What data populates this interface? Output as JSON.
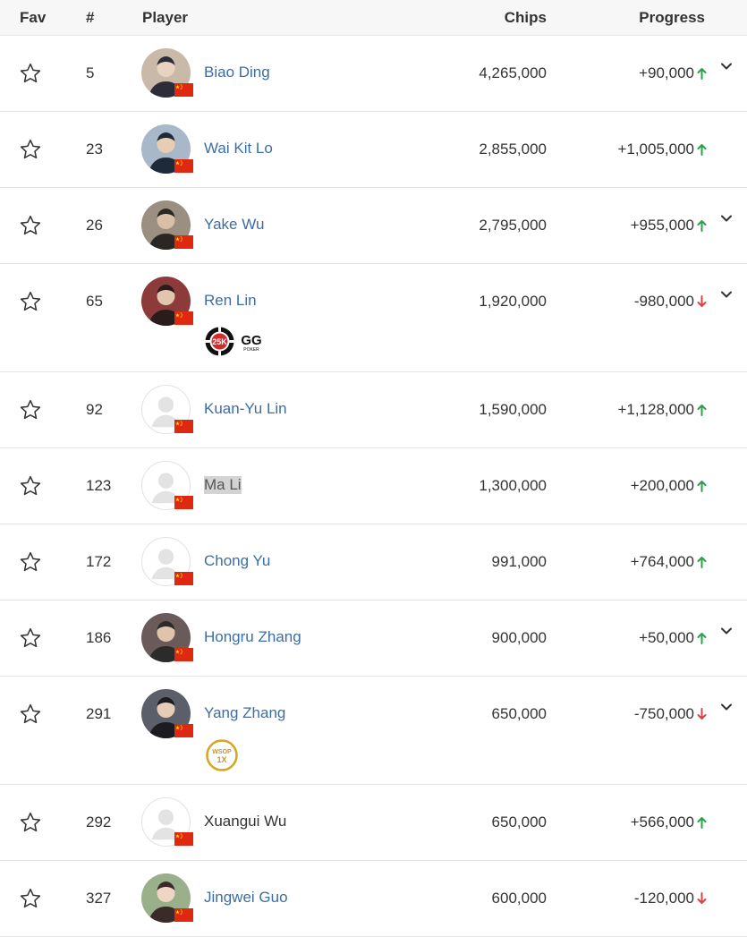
{
  "table": {
    "headers": {
      "fav": "Fav",
      "rank": "#",
      "player": "Player",
      "chips": "Chips",
      "progress": "Progress"
    },
    "colors": {
      "link": "#3b6ea5",
      "up": "#2e9e4f",
      "down": "#d64545"
    },
    "rows": [
      {
        "rank": "5",
        "name": "Biao Ding",
        "chips": "4,265,000",
        "progress": "+90,000",
        "trend": "up",
        "expandable": true,
        "avatar": "photo",
        "badges": []
      },
      {
        "rank": "23",
        "name": "Wai Kit Lo",
        "chips": "2,855,000",
        "progress": "+1,005,000",
        "trend": "up",
        "expandable": false,
        "avatar": "photo",
        "badges": []
      },
      {
        "rank": "26",
        "name": "Yake Wu",
        "chips": "2,795,000",
        "progress": "+955,000",
        "trend": "up",
        "expandable": true,
        "avatar": "photo",
        "badges": []
      },
      {
        "rank": "65",
        "name": "Ren Lin",
        "chips": "1,920,000",
        "progress": "-980,000",
        "trend": "down",
        "expandable": true,
        "avatar": "photo",
        "badges": [
          "25k-chip",
          "ggpoker-logo"
        ],
        "badge_text": {
          "chip": "25K",
          "gg": "GG",
          "gg_sub": "POKER"
        }
      },
      {
        "rank": "92",
        "name": "Kuan-Yu Lin",
        "chips": "1,590,000",
        "progress": "+1,128,000",
        "trend": "up",
        "expandable": false,
        "avatar": "placeholder",
        "badges": []
      },
      {
        "rank": "123",
        "name": "Ma Li",
        "chips": "1,300,000",
        "progress": "+200,000",
        "trend": "up",
        "expandable": false,
        "avatar": "placeholder",
        "badges": [],
        "highlighted": true
      },
      {
        "rank": "172",
        "name": "Chong Yu",
        "chips": "991,000",
        "progress": "+764,000",
        "trend": "up",
        "expandable": false,
        "avatar": "placeholder",
        "badges": []
      },
      {
        "rank": "186",
        "name": "Hongru Zhang",
        "chips": "900,000",
        "progress": "+50,000",
        "trend": "up",
        "expandable": true,
        "avatar": "photo",
        "badges": []
      },
      {
        "rank": "291",
        "name": "Yang Zhang",
        "chips": "650,000",
        "progress": "-750,000",
        "trend": "down",
        "expandable": true,
        "avatar": "photo",
        "badges": [
          "wsop-bracelet"
        ],
        "badge_text": {
          "wsop": "WSOP",
          "count": "1X"
        }
      },
      {
        "rank": "292",
        "name": "Xuangui Wu",
        "chips": "650,000",
        "progress": "+566,000",
        "trend": "up",
        "expandable": false,
        "avatar": "placeholder",
        "badges": [],
        "plain": true
      },
      {
        "rank": "327",
        "name": "Jingwei Guo",
        "chips": "600,000",
        "progress": "-120,000",
        "trend": "down",
        "expandable": false,
        "avatar": "photo",
        "badges": []
      }
    ]
  },
  "icons": {
    "favorite": "star-outline-icon",
    "expand": "chevron-down-icon",
    "flag": "china-flag-icon",
    "up": "arrow-up-icon",
    "down": "arrow-down-icon"
  }
}
